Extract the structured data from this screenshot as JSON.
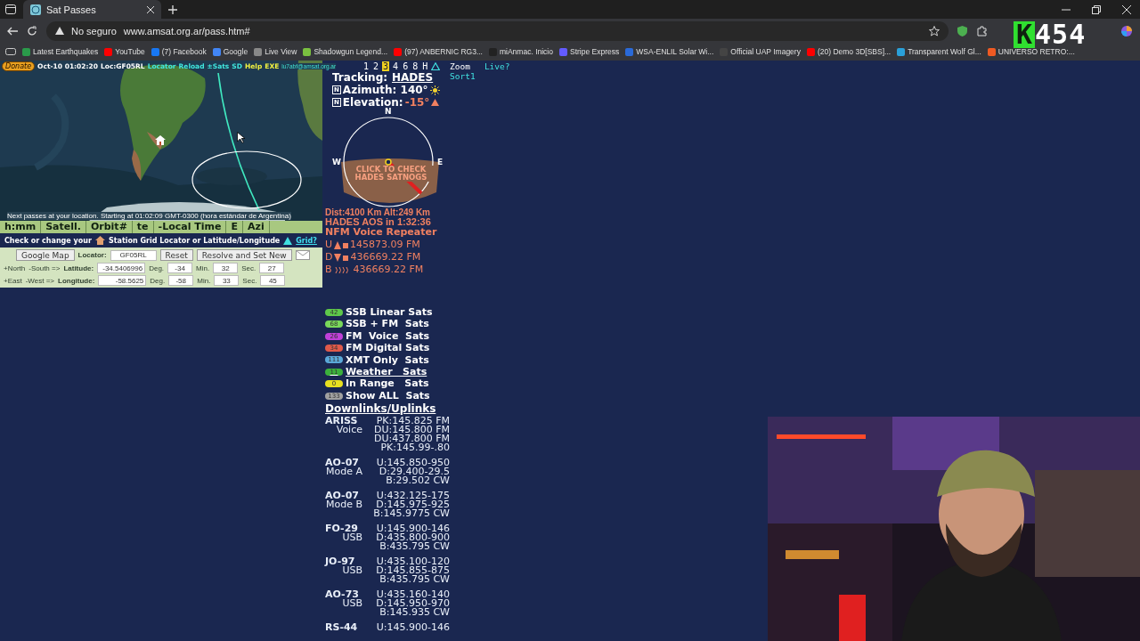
{
  "browser": {
    "tab_title": "Sat Passes",
    "security": "No seguro",
    "url": "www.amsat.org.ar/pass.htm#",
    "bookmarks": [
      "Latest Earthquakes",
      "YouTube",
      "(7) Facebook",
      "Google",
      "Live View",
      "Shadowgun Legend...",
      "(97) ANBERNIC RG3...",
      "miAnmac. Inicio",
      "Stripe Express",
      "WSA-ENLIL Solar Wi...",
      "Official UAP Imagery",
      "(20) Demo 3D[SBS]...",
      "Transparent Wolf Gl...",
      "UNIVERSO RETRO:..."
    ]
  },
  "stream_overlay": {
    "letter": "K",
    "count": "454"
  },
  "map_header": {
    "donate": "Donate",
    "time": "Oct-10 01:02:20",
    "locator": "Loc:GF05RL",
    "links": [
      {
        "label": "Locator",
        "kind": "cyan"
      },
      {
        "label": "Reload",
        "kind": "cyan"
      },
      {
        "label": "±Sats",
        "kind": "cyan"
      },
      {
        "label": "SD",
        "kind": "cyan"
      },
      {
        "label": "Help",
        "kind": "yellow"
      },
      {
        "label": "EXE",
        "kind": "yellow"
      }
    ],
    "email": "lu7abf@amsat.org.ar",
    "next_passes": "Next passes at your location. Starting at 01:02:09 GMT-0300 (hora estándar de Argentina)"
  },
  "hours": [
    {
      "label": "1",
      "selected": false
    },
    {
      "label": "2",
      "selected": false
    },
    {
      "label": "3",
      "selected": true
    },
    {
      "label": "4",
      "selected": false
    },
    {
      "label": "6",
      "selected": false
    },
    {
      "label": "8",
      "selected": false
    },
    {
      "label": "H",
      "selected": false
    }
  ],
  "view_links": {
    "zoom": "Zoom",
    "live": "Live?",
    "sort": "Sort1"
  },
  "table_header": [
    "h:mm",
    "Satell.",
    "Orbit#",
    "te",
    "-Local Time",
    "E",
    "Azi"
  ],
  "station": {
    "prompt": "Check or change your",
    "station_label": "Station Grid Locator  or Latitude/Longitude",
    "grid_link": "Grid?",
    "google_map": "Google Map",
    "locator_label": "Locator:",
    "locator": "GF05RL",
    "reset": "Reset",
    "resolve": "Resolve and Set New",
    "rows": [
      {
        "dir1": "+North",
        "dir2": "-South =>",
        "label": "Latitude:",
        "value": "-34.5406996",
        "deg_label": "Deg.",
        "deg": "-34",
        "min_label": "Min.",
        "min": "32",
        "sec_label": "Sec.",
        "sec": "27"
      },
      {
        "dir1": "+East",
        "dir2": "-West =>",
        "label": "Longitude:",
        "value": "-58.5625",
        "deg_label": "Deg.",
        "deg": "-58",
        "min_label": "Min.",
        "min": "33",
        "sec_label": "Sec.",
        "sec": "45"
      }
    ]
  },
  "tracking": {
    "label": "Tracking:",
    "satellite": "HADES",
    "az_key": "N",
    "azimuth": "Azimuth: 140°",
    "el_key": "N",
    "el_label": "Elevation:",
    "elevation": "-15°",
    "polar": {
      "n": "N",
      "w": "W",
      "e": "E",
      "overlay": "CLICK TO CHECK HADES SATNOGS"
    },
    "dist": "Dist:4100 Km  Alt:249 Km",
    "aos": "HADES AOS in 1:32:36",
    "mode": "NFM Voice Repeater",
    "freqs": [
      {
        "band": "U",
        "kind": "up",
        "value": "145873.09 FM"
      },
      {
        "band": "D",
        "kind": "down",
        "value": "436669.22 FM"
      },
      {
        "band": "B",
        "kind": "beacon",
        "value": "436669.22 FM"
      }
    ]
  },
  "sat_groups": [
    {
      "count": "42",
      "label": "SSB Linear Sats",
      "color": "#5fc84a",
      "underlined": false
    },
    {
      "count": "68",
      "label": "SSB + FM  Sats",
      "color": "#7ad85a",
      "underlined": false
    },
    {
      "count": "26",
      "label": "FM  Voice  Sats",
      "color": "#c040d8",
      "underlined": false
    },
    {
      "count": "34",
      "label": "FM Digital Sats",
      "color": "#e05a4a",
      "underlined": false
    },
    {
      "count": "111",
      "label": "XMT Only  Sats",
      "color": "#5aa8d8",
      "underlined": false
    },
    {
      "count": "11",
      "label": "Weather   Sats",
      "color": "#3cb03c",
      "underlined": true
    },
    {
      "count": "0",
      "label": "In Range   Sats",
      "color": "#e8e020",
      "underlined": false
    },
    {
      "count": "133",
      "label": "Show ALL  Sats",
      "color": "#a0a0a0",
      "underlined": false
    }
  ],
  "downlinks_title": "Downlinks/Uplinks",
  "downlinks": [
    {
      "name": "ARISS",
      "mode": "Voice",
      "lines": [
        "PK:145.825 FM",
        "DU:145.800 FM",
        "DU:437.800 FM",
        "PK:145.99-.80"
      ]
    },
    {
      "name": "AO-07",
      "mode": "Mode A",
      "lines": [
        "U:145.850-950",
        "D:29.400-29.5",
        "B:29.502 CW"
      ]
    },
    {
      "name": "AO-07",
      "mode": "Mode B",
      "lines": [
        "U:432.125-175",
        "D:145.975-925",
        "B:145.9775 CW"
      ]
    },
    {
      "name": "FO-29",
      "mode": "USB",
      "lines": [
        "U:145.900-146",
        "D:435.800-900",
        "B:435.795 CW"
      ]
    },
    {
      "name": "JO-97",
      "mode": "USB",
      "lines": [
        "U:435.100-120",
        "D:145.855-875",
        "B:435.795 CW"
      ]
    },
    {
      "name": "AO-73",
      "mode": "USB",
      "lines": [
        "U:435.160-140",
        "D:145.950-970",
        "B:145.935 CW"
      ]
    },
    {
      "name": "RS-44",
      "lines": [
        "U:145.900-146"
      ]
    }
  ]
}
